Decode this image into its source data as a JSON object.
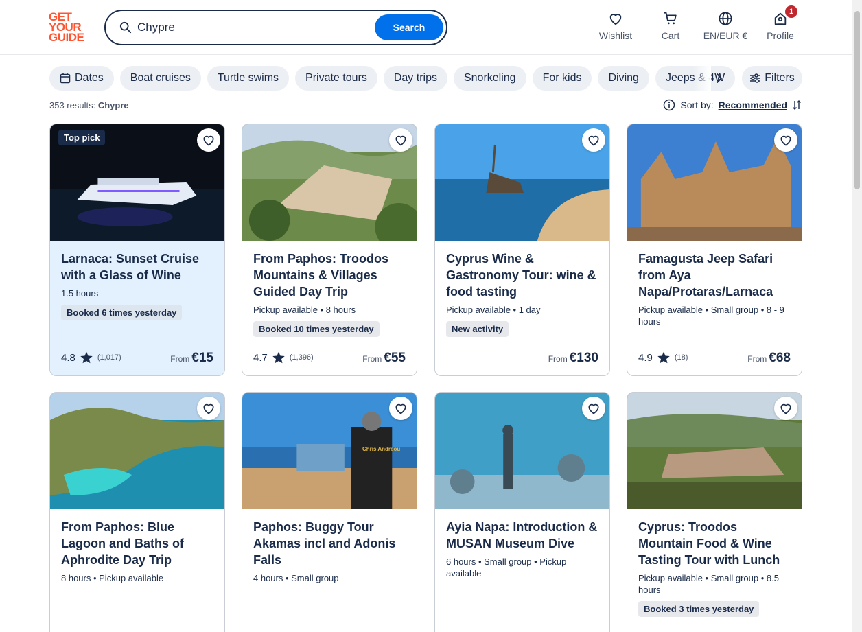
{
  "logo": {
    "line1": "GET",
    "line2": "YOUR",
    "line3": "GUIDE"
  },
  "search": {
    "value": "Chypre",
    "button_label": "Search"
  },
  "nav": {
    "wishlist": "Wishlist",
    "cart": "Cart",
    "language": "EN/EUR €",
    "profile": "Profile",
    "profile_badge": "1"
  },
  "chips": [
    "Dates",
    "Boat cruises",
    "Turtle swims",
    "Private tours",
    "Day trips",
    "Snorkeling",
    "For kids",
    "Diving",
    "Jeeps & 4W"
  ],
  "filters_label": "Filters",
  "results": {
    "count": "353 results:",
    "query": "Chypre"
  },
  "sort": {
    "label": "Sort by:",
    "value": "Recommended"
  },
  "cards": [
    {
      "title": "Larnaca: Sunset Cruise with a Glass of Wine",
      "meta": "1.5 hours",
      "tag": "Booked 6 times yesterday",
      "rating": "4.8",
      "reviews": "(1,017)",
      "from": "From",
      "price": "€15",
      "badge": "Top pick"
    },
    {
      "title": "From Paphos: Troodos Mountains & Villages Guided Day Trip",
      "meta": "Pickup available • 8 hours",
      "tag": "Booked 10 times yesterday",
      "rating": "4.7",
      "reviews": "(1,396)",
      "from": "From",
      "price": "€55"
    },
    {
      "title": "Cyprus Wine & Gastronomy Tour: wine & food tasting",
      "meta": "Pickup available • 1 day",
      "tag": "New activity",
      "from": "From",
      "price": "€130"
    },
    {
      "title": "Famagusta Jeep Safari from Aya Napa/Protaras/Larnaca",
      "meta": "Pickup available • Small group • 8 - 9 hours",
      "rating": "4.9",
      "reviews": "(18)",
      "from": "From",
      "price": "€68"
    },
    {
      "title": "From Paphos: Blue Lagoon and Baths of Aphrodite Day Trip",
      "meta": "8 hours • Pickup available"
    },
    {
      "title": "Paphos: Buggy Tour Akamas incl and Adonis Falls",
      "meta": "4 hours • Small group",
      "image_text": "Chris Andreou"
    },
    {
      "title": "Ayia Napa: Introduction & MUSAN Museum Dive",
      "meta": "6 hours • Small group • Pickup available"
    },
    {
      "title": "Cyprus: Troodos Mountain Food & Wine Tasting Tour with Lunch",
      "meta": "Pickup available • Small group • 8.5 hours",
      "tag": "Booked 3 times yesterday"
    }
  ],
  "colors": {
    "brand": "#ff5533",
    "primary_blue": "#0071eb",
    "text_navy": "#1a2b49",
    "highlight_bg": "#e3f0fd",
    "badge_red": "#c0282f"
  }
}
